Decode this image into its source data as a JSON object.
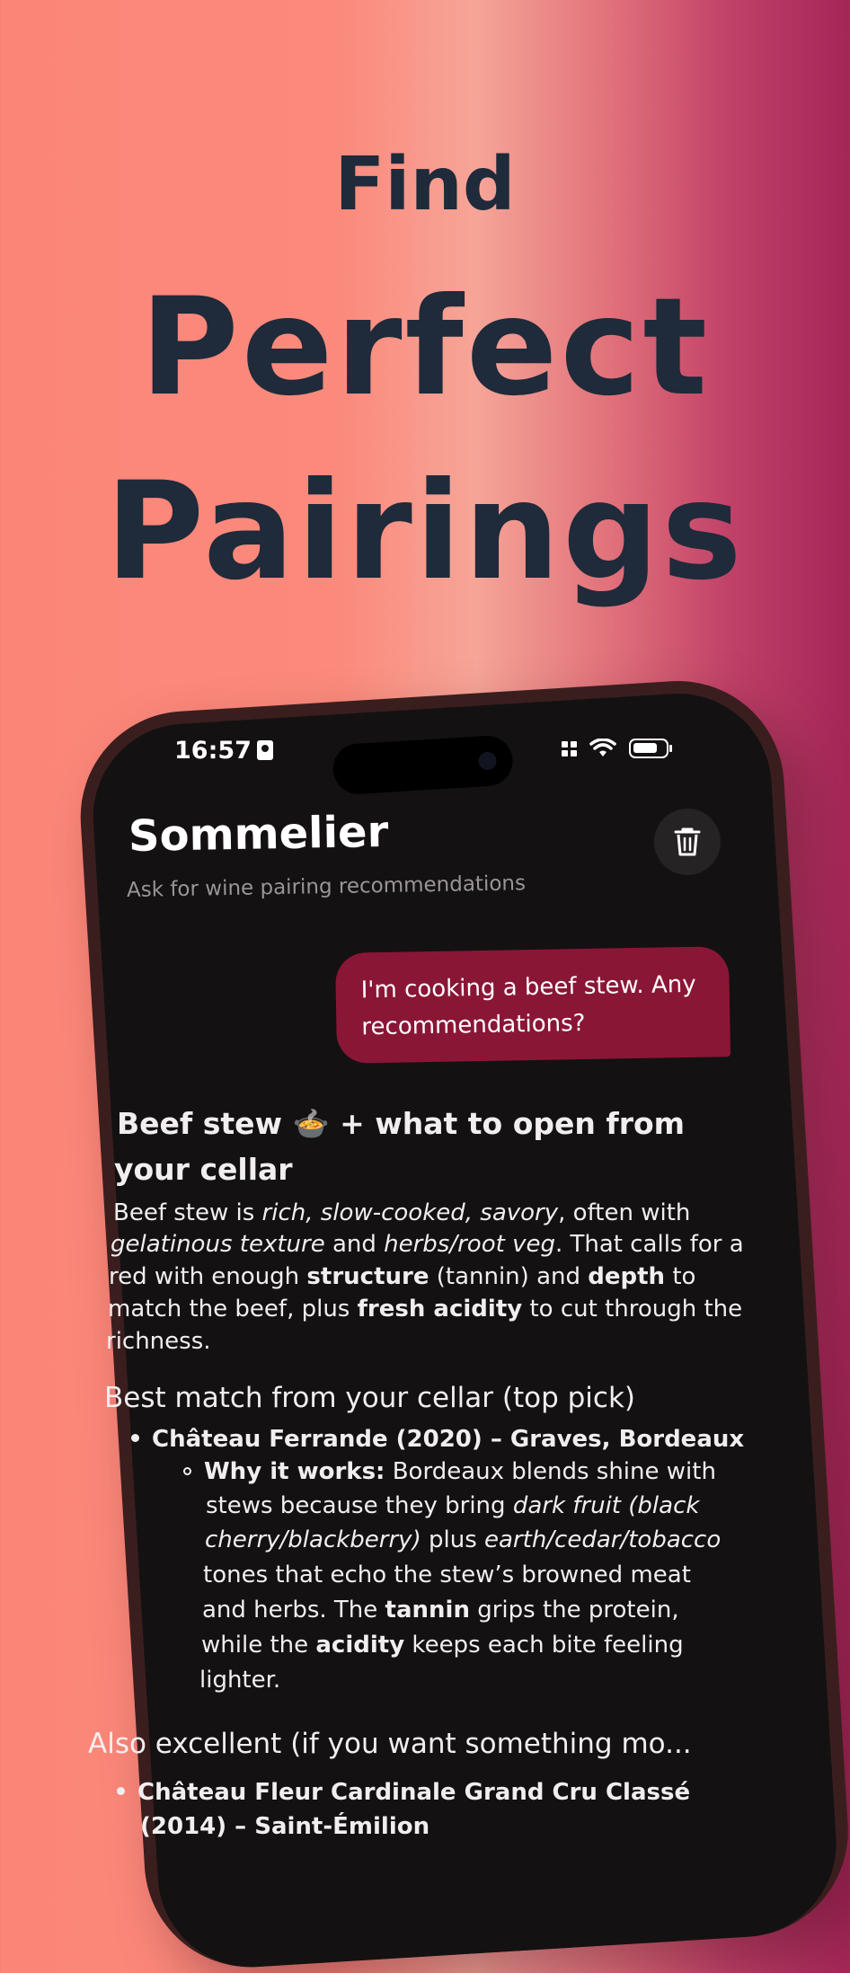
{
  "hero": {
    "line1": "Find",
    "line2": "Perfect",
    "line3": "Pairings"
  },
  "status_bar": {
    "time": "16:57"
  },
  "header": {
    "title": "Sommelier",
    "subtitle": "Ask for wine pairing recommendations",
    "trash_icon": "trash-icon"
  },
  "messages": {
    "user": {
      "line1": "I'm cooking a beef stew. Any",
      "line2": "recommendations?"
    },
    "reply": {
      "heading_line1": "Beef stew 🍲 + what to open from",
      "heading_line2": "your cellar",
      "p1": {
        "a": "Beef stew is ",
        "b": "rich, slow-cooked, savory",
        "c": ", often with",
        "d": "gelatinous texture",
        "e": " and ",
        "f": "herbs/root veg",
        "g": ". That calls for a",
        "h": "red with enough ",
        "i": "structure",
        "j": " (tannin) and ",
        "k": "depth",
        "l": " to",
        "m": "match the beef, plus ",
        "n": "fresh acidity",
        "o": " to cut through the",
        "p": "richness."
      },
      "section1_title": "Best match from your cellar (top pick)",
      "pick1": "Château Ferrande (2020) – Graves, Bordeaux",
      "why": {
        "label": "Why it works:",
        "a": " Bordeaux blends shine with",
        "b": "stews because they bring ",
        "c": "dark fruit (black",
        "d": "cherry/blackberry)",
        "e": " plus ",
        "f": "earth/cedar/tobacco",
        "g": "tones that echo the stew’s browned meat",
        "h": "and herbs. The ",
        "i": "tannin",
        "j": " grips the protein,",
        "k": "while the ",
        "l": "acidity",
        "m": " keeps each bite feeling",
        "n": "lighter."
      },
      "section2_title": "Also excellent (if you want something mo...",
      "pick2_line1": "Château Fleur Cardinale Grand Cru Classé",
      "pick2_line2": "(2014) – Saint-Émilion"
    }
  }
}
